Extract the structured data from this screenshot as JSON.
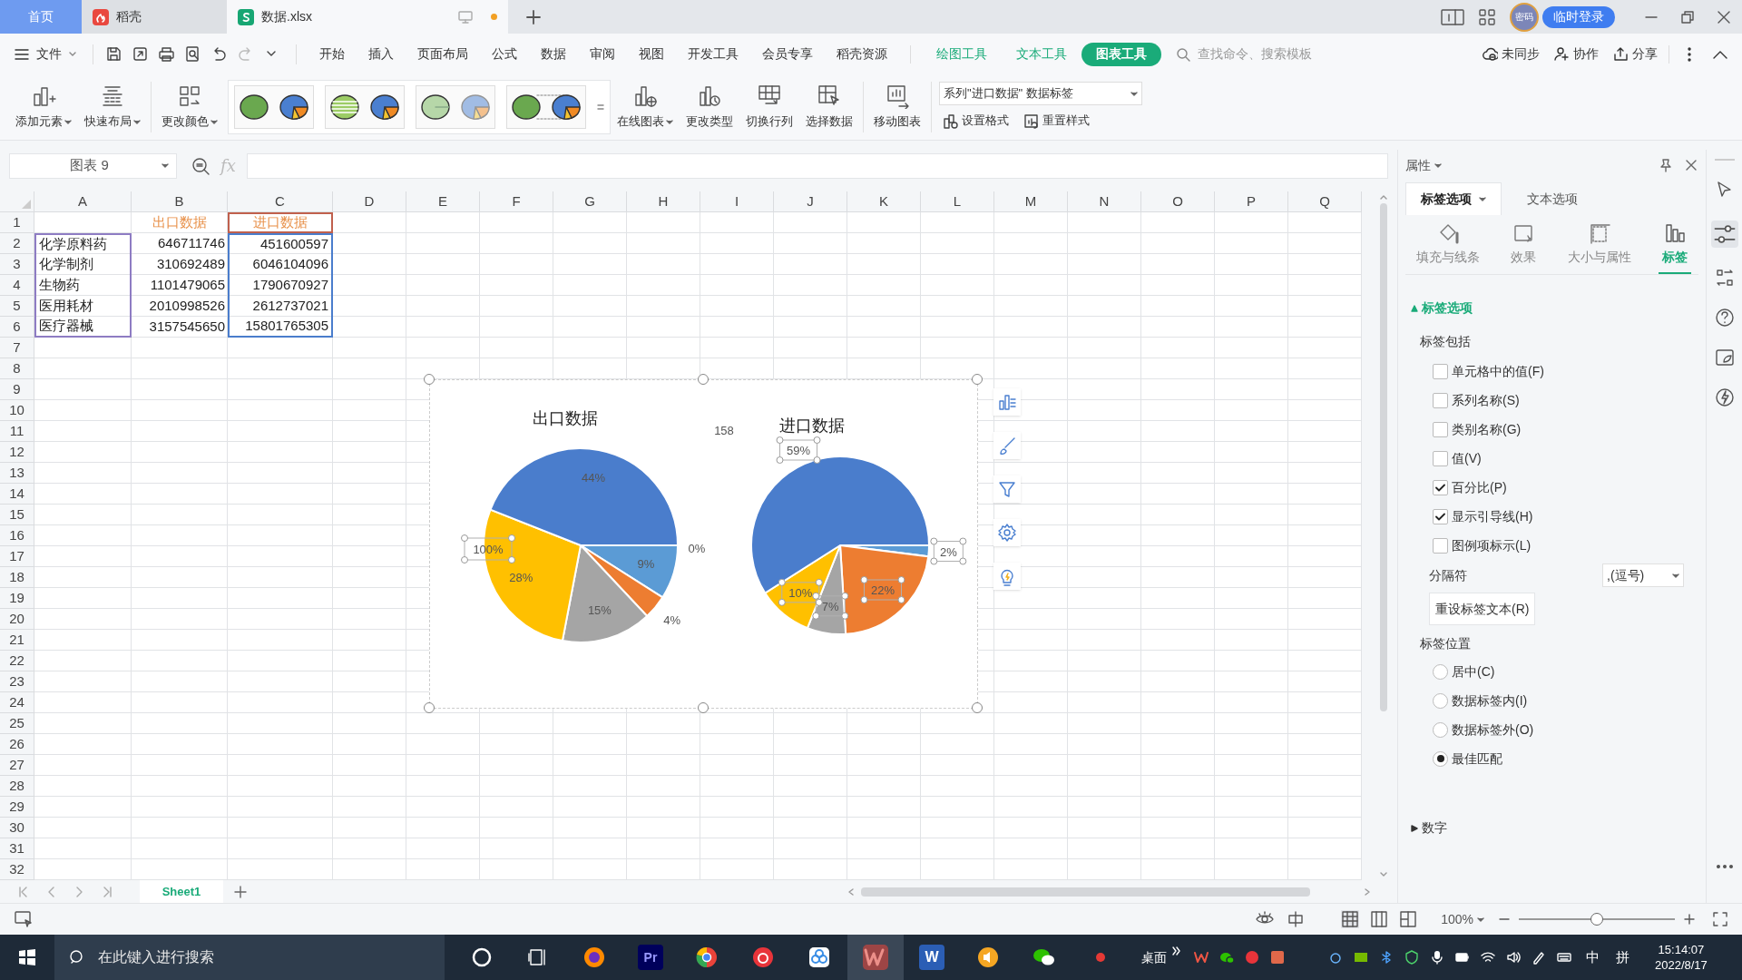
{
  "tabs": [
    {
      "label": "首页",
      "kind": "home",
      "selected": false
    },
    {
      "label": "稻壳",
      "kind": "docer",
      "selected": false
    },
    {
      "label": "数据.xlsx",
      "kind": "sheet",
      "selected": true,
      "unsaved": true
    }
  ],
  "account": {
    "avatar": "密码",
    "login": "临时登录"
  },
  "menu": {
    "file": "文件",
    "items": [
      {
        "label": "开始",
        "kind": "plain",
        "selected": false
      },
      {
        "label": "插入",
        "kind": "plain",
        "selected": false
      },
      {
        "label": "页面布局",
        "kind": "plain",
        "selected": false
      },
      {
        "label": "公式",
        "kind": "plain",
        "selected": false
      },
      {
        "label": "数据",
        "kind": "plain",
        "selected": false
      },
      {
        "label": "审阅",
        "kind": "plain",
        "selected": false
      },
      {
        "label": "视图",
        "kind": "plain",
        "selected": false
      },
      {
        "label": "开发工具",
        "kind": "plain",
        "selected": false
      },
      {
        "label": "会员专享",
        "kind": "plain",
        "selected": false
      },
      {
        "label": "稻壳资源",
        "kind": "plain",
        "selected": false
      },
      {
        "label": "绘图工具",
        "kind": "context",
        "selected": false
      },
      {
        "label": "文本工具",
        "kind": "context",
        "selected": false
      },
      {
        "label": "图表工具",
        "kind": "context",
        "selected": true
      }
    ],
    "search": {
      "placeholder": "查找命令、搜索模板"
    },
    "actions": [
      "未同步",
      "协作",
      "分享"
    ]
  },
  "ribbon": {
    "groups": [
      {
        "label": "添加元素",
        "dropdown": true
      },
      {
        "label": "快速布局",
        "dropdown": true
      },
      {
        "label": "更改颜色",
        "dropdown": true
      }
    ],
    "styles": [
      {
        "kind": "solid"
      },
      {
        "kind": "striped"
      },
      {
        "kind": "light"
      },
      {
        "kind": "dashed"
      }
    ],
    "tools": [
      {
        "label": "在线图表",
        "dropdown": true
      },
      {
        "label": "更改类型",
        "dropdown": false
      },
      {
        "label": "切换行列",
        "dropdown": false
      },
      {
        "label": "选择数据",
        "dropdown": false
      },
      {
        "label": "移动图表",
        "dropdown": false
      }
    ],
    "element_select": "系列\"进口数据\" 数据标签",
    "format": [
      "设置格式",
      "重置样式"
    ]
  },
  "formula_bar": {
    "name_box": "图表 9",
    "fx": "fx"
  },
  "sheet": {
    "columns": [
      "A",
      "B",
      "C",
      "D",
      "E",
      "F",
      "G",
      "H",
      "I",
      "J",
      "K",
      "L",
      "M",
      "N",
      "O",
      "P",
      "Q"
    ],
    "row_numbers": [
      "1",
      "2",
      "3",
      "4",
      "5",
      "6",
      "7",
      "8",
      "9",
      "10",
      "11",
      "12",
      "13",
      "14",
      "15",
      "16",
      "17",
      "18",
      "19",
      "20",
      "21",
      "22",
      "23",
      "24",
      "25",
      "26",
      "27",
      "28",
      "29",
      "30",
      "31",
      "32"
    ],
    "rows": [
      {
        "b": {
          "text": "出口数据",
          "kind": "header"
        },
        "c": {
          "text": "进口数据",
          "kind": "header",
          "color": "#c0604d"
        }
      },
      {
        "a": {
          "text": "化学原料药",
          "kind": "text",
          "color": "#8e7cc3"
        },
        "b": {
          "text": "646711746",
          "kind": "number"
        },
        "c": {
          "text": "451600597",
          "kind": "number",
          "color": "#4a7dcc"
        }
      },
      {
        "a": {
          "text": "化学制剂",
          "kind": "text",
          "color": "#8e7cc3"
        },
        "b": {
          "text": "310692489",
          "kind": "number"
        },
        "c": {
          "text": "6046104096",
          "kind": "number",
          "color": "#4a7dcc"
        }
      },
      {
        "a": {
          "text": "生物药",
          "kind": "text",
          "color": "#8e7cc3"
        },
        "b": {
          "text": "1101479065",
          "kind": "number"
        },
        "c": {
          "text": "1790670927",
          "kind": "number",
          "color": "#4a7dcc"
        }
      },
      {
        "a": {
          "text": "医用耗材",
          "kind": "text",
          "color": "#8e7cc3"
        },
        "b": {
          "text": "2010998526",
          "kind": "number"
        },
        "c": {
          "text": "2612737021",
          "kind": "number",
          "color": "#4a7dcc"
        }
      },
      {
        "a": {
          "text": "医疗器械",
          "kind": "text",
          "color": "#8e7cc3"
        },
        "b": {
          "text": "3157545650",
          "kind": "number"
        },
        "c": {
          "text": "15801765305",
          "kind": "number",
          "color": "#4a7dcc"
        }
      }
    ]
  },
  "charts": [
    {
      "labels_selected": false,
      "chart_data": {
        "type": "pie",
        "title": "出口数据",
        "values": [
          9,
          4,
          15,
          28,
          44
        ],
        "value_labels": [
          "9%",
          "4%",
          "15%",
          "28%",
          "44%"
        ],
        "annotations": [
          "100%",
          "0%"
        ]
      }
    },
    {
      "labels_selected": true,
      "chart_data": {
        "type": "pie",
        "title": "进口数据",
        "values": [
          2,
          22,
          7,
          10,
          59
        ],
        "value_labels": [
          "2%",
          "22%",
          "7%",
          "10%",
          "59%"
        ],
        "annotations": [
          "158"
        ]
      }
    }
  ],
  "panel": {
    "title": "属性",
    "tabs": [
      {
        "label": "标签选项",
        "selected": true
      },
      {
        "label": "文本选项",
        "selected": false
      }
    ],
    "subtabs": [
      {
        "label": "填充与线条",
        "selected": false
      },
      {
        "label": "效果",
        "selected": false
      },
      {
        "label": "大小与属性",
        "selected": false
      },
      {
        "label": "标签",
        "selected": true
      }
    ],
    "label_options": {
      "title": "标签选项",
      "expanded": true,
      "include_heading": "标签包括",
      "checkboxes": [
        {
          "label": "单元格中的值(F)",
          "checked": false
        },
        {
          "label": "系列名称(S)",
          "checked": false
        },
        {
          "label": "类别名称(G)",
          "checked": false
        },
        {
          "label": "值(V)",
          "checked": false
        },
        {
          "label": "百分比(P)",
          "checked": true
        },
        {
          "label": "显示引导线(H)",
          "checked": true
        },
        {
          "label": "图例项标示(L)",
          "checked": false
        }
      ],
      "separator": {
        "label": "分隔符",
        "value": ",(逗号)"
      },
      "reset_button": "重设标签文本(R)",
      "position_heading": "标签位置",
      "positions": [
        {
          "label": "居中(C)",
          "selected": false
        },
        {
          "label": "数据标签内(I)",
          "selected": false
        },
        {
          "label": "数据标签外(O)",
          "selected": false
        },
        {
          "label": "最佳匹配",
          "selected": true
        }
      ]
    },
    "number_section": {
      "title": "数字",
      "expanded": false
    }
  },
  "sheet_tabs": [
    {
      "label": "Sheet1",
      "selected": true
    }
  ],
  "status_bar": {
    "zoom": "100%",
    "zoom_slider": {
      "level": 0.5
    }
  },
  "taskbar": {
    "search_placeholder": "在此键入进行搜索",
    "app_letters": [
      "Pr",
      "W"
    ],
    "desktop": "桌面",
    "ime": "中",
    "ime_mode": "拼",
    "time": "15:14:07",
    "date": "2022/8/17"
  }
}
